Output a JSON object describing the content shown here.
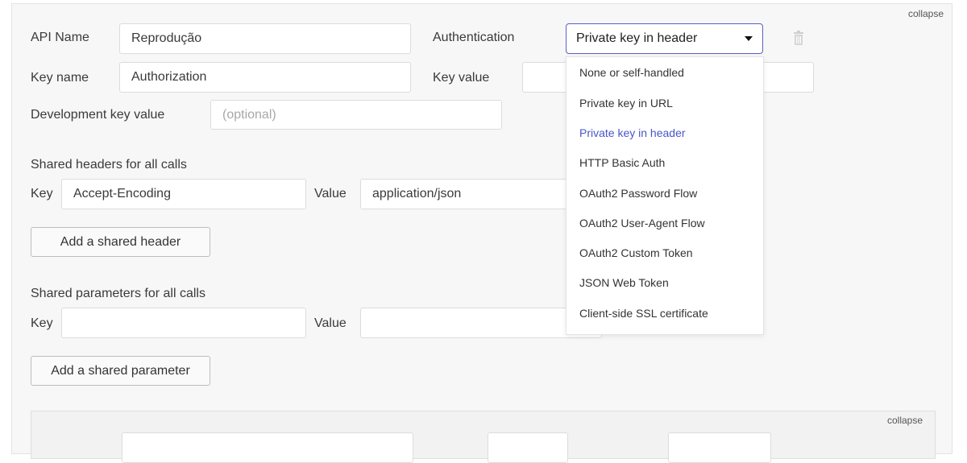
{
  "collapse_label": "collapse",
  "api": {
    "name_label": "API Name",
    "name_value": "Reprodução",
    "auth_label": "Authentication",
    "auth_selected": "Private key in header",
    "key_name_label": "Key name",
    "key_name_value": "Authorization",
    "key_value_label": "Key value",
    "dev_key_label": "Development key value",
    "dev_key_placeholder": "(optional)"
  },
  "auth_options": [
    "None or self-handled",
    "Private key in URL",
    "Private key in header",
    "HTTP Basic Auth",
    "OAuth2 Password Flow",
    "OAuth2 User-Agent Flow",
    "OAuth2 Custom Token",
    "JSON Web Token",
    "Client-side SSL certificate"
  ],
  "headers": {
    "title": "Shared headers for all calls",
    "key_label": "Key",
    "key_value": "Accept-Encoding",
    "value_label": "Value",
    "value_value": "application/json",
    "add_button": "Add a shared header"
  },
  "params": {
    "title": "Shared parameters for all calls",
    "key_label": "Key",
    "value_label": "Value",
    "add_button": "Add a shared parameter"
  },
  "inner_collapse_label": "collapse",
  "colors": {
    "accent": "#5b5fc7",
    "selected_option": "#4a55c8",
    "panel_bg": "#f7f7f7"
  },
  "icons": {
    "delete": "trash-icon",
    "caret": "caret-down-icon"
  }
}
